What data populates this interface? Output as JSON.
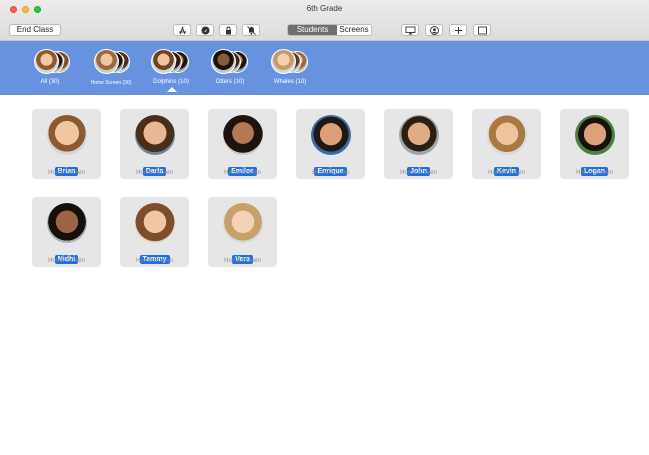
{
  "window": {
    "title": "6th Grade"
  },
  "toolbar": {
    "end_class_label": "End Class",
    "tools": [
      "app-store-icon",
      "compass-icon",
      "lock-icon",
      "mute-icon"
    ],
    "view_segments": {
      "students_label": "Students",
      "screens_label": "Screens",
      "selected": "Students"
    },
    "right_tools": [
      "airplay-icon",
      "person-icon",
      "plus-icon",
      "square-icon"
    ]
  },
  "groups": [
    {
      "label": "All (30)"
    },
    {
      "label": "Home Screen (30)"
    },
    {
      "label": "Dolphins (10)",
      "selected": true
    },
    {
      "label": "Otters (10)"
    },
    {
      "label": "Whales (10)"
    }
  ],
  "students": [
    {
      "name": "Brian",
      "status": "Home Screen"
    },
    {
      "name": "Darla",
      "status": "Home Screen"
    },
    {
      "name": "Emilee",
      "status": "Home Screen"
    },
    {
      "name": "Enrique",
      "status": "Home Screen"
    },
    {
      "name": "John",
      "status": "Home Screen"
    },
    {
      "name": "Kevin",
      "status": "Home Screen"
    },
    {
      "name": "Logan",
      "status": "Home Screen"
    },
    {
      "name": "Nidhi",
      "status": "Home Screen"
    },
    {
      "name": "Tammy",
      "status": "Home Screen"
    },
    {
      "name": "Vera",
      "status": "Home Screen"
    }
  ],
  "colors": {
    "accent": "#6792e0",
    "name_badge": "#1f6fe0",
    "segment_selected": "#6f6f6f"
  }
}
